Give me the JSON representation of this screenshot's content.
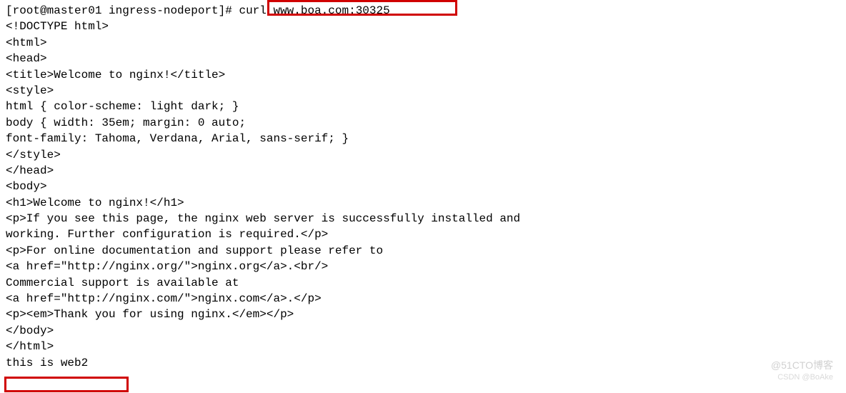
{
  "prompt": {
    "user_host": "[root@master01 ingress-nodeport]#",
    "command": " curl www.boa.com:30325"
  },
  "output": {
    "l01": "<!DOCTYPE html>",
    "l02": "<html>",
    "l03": "<head>",
    "l04": "<title>Welcome to nginx!</title>",
    "l05": "<style>",
    "l06": "html { color-scheme: light dark; }",
    "l07": "body { width: 35em; margin: 0 auto;",
    "l08": "font-family: Tahoma, Verdana, Arial, sans-serif; }",
    "l09": "</style>",
    "l10": "</head>",
    "l11": "<body>",
    "l12": "<h1>Welcome to nginx!</h1>",
    "l13": "<p>If you see this page, the nginx web server is successfully installed and",
    "l14": "working. Further configuration is required.</p>",
    "l15": "",
    "l16": "<p>For online documentation and support please refer to",
    "l17": "<a href=\"http://nginx.org/\">nginx.org</a>.<br/>",
    "l18": "Commercial support is available at",
    "l19": "<a href=\"http://nginx.com/\">nginx.com</a>.</p>",
    "l20": "",
    "l21": "<p><em>Thank you for using nginx.</em></p>",
    "l22": "</body>",
    "l23": "</html>",
    "l24": "this is web2"
  },
  "watermark": {
    "main": "@51CTO博客",
    "sub": "CSDN @BoAke"
  }
}
